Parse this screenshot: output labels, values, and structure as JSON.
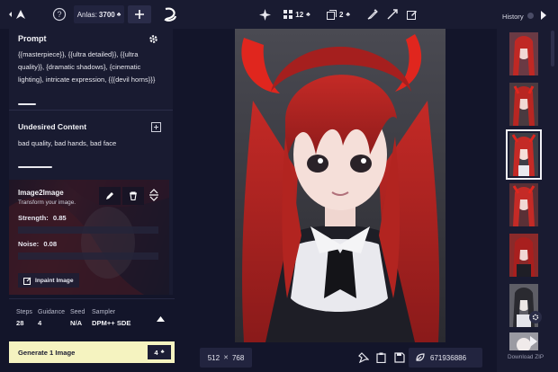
{
  "topbar": {
    "anlas_label": "Anlas:",
    "anlas_value": "3700",
    "image_count": "12",
    "steps_count": "2"
  },
  "prompt": {
    "title": "Prompt",
    "text": "{{masterpiece}}, {{ultra detailed}}, {{ultra quality}}, {dramatic shadows}, {cinematic lighting}, intricate expression, {{{devil horns}}}"
  },
  "undesired": {
    "title": "Undesired Content",
    "text": "bad quality, bad hands, bad face"
  },
  "image2image": {
    "title": "Image2Image",
    "subtitle": "Transform your image.",
    "strength_label": "Strength:",
    "strength_value": "0.85",
    "noise_label": "Noise:",
    "noise_value": "0.08",
    "inpaint_label": "Inpaint Image"
  },
  "params": {
    "steps_label": "Steps",
    "steps_value": "28",
    "guidance_label": "Guidance",
    "guidance_value": "4",
    "seed_label": "Seed",
    "seed_value": "N/A",
    "sampler_label": "Sampler",
    "sampler_value": "DPM++ SDE"
  },
  "generate": {
    "label": "Generate 1 Image",
    "count": "4"
  },
  "canvas": {
    "width": "512",
    "times": "✕",
    "height": "768",
    "seed": "671936886"
  },
  "history": {
    "title": "History",
    "download": "Download ZIP"
  },
  "colors": {
    "background": "#13152a",
    "panel": "#191b31",
    "accent_yellow": "#f5f3c0",
    "horn_red": "#e0261e"
  }
}
